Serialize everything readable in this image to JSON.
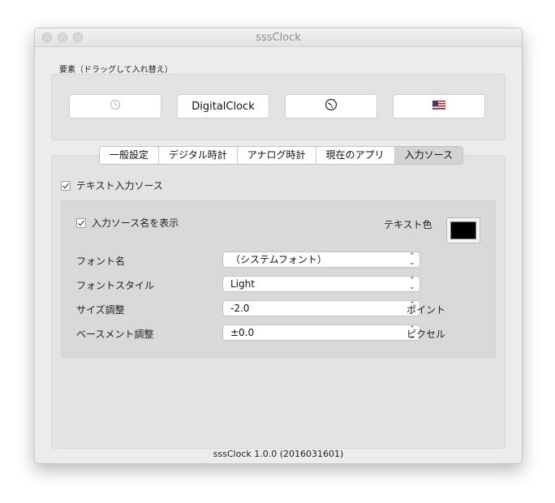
{
  "window": {
    "title": "sssClock"
  },
  "elements": {
    "label": "要素（ドラッグして入れ替え）",
    "items": [
      {
        "type": "icon",
        "icon": "clock-icon"
      },
      {
        "type": "text",
        "label": "DigitalClock"
      },
      {
        "type": "icon",
        "icon": "analog-clock-icon"
      },
      {
        "type": "icon",
        "icon": "us-flag-icon"
      }
    ]
  },
  "tabs": [
    {
      "label": "一般設定",
      "active": false
    },
    {
      "label": "デジタル時計",
      "active": false
    },
    {
      "label": "アナログ時計",
      "active": false
    },
    {
      "label": "現在のアプリ",
      "active": false
    },
    {
      "label": "入力ソース",
      "active": true
    }
  ],
  "input_source": {
    "text_source_checkbox": {
      "label": "テキスト入力ソース",
      "checked": true
    },
    "show_name_checkbox": {
      "label": "入力ソース名を表示",
      "checked": true
    },
    "text_color": {
      "label": "テキスト色",
      "value": "#000000"
    },
    "font_name": {
      "label": "フォント名",
      "value": "（システムフォント）"
    },
    "font_style": {
      "label": "フォントスタイル",
      "value": "Light"
    },
    "size_adjust": {
      "label": "サイズ調整",
      "value": "-2.0",
      "unit": "ポイント"
    },
    "baseline_adjust": {
      "label": "ベースメント調整",
      "value": "±0.0",
      "unit": "ピクセル"
    }
  },
  "footer": {
    "version": "sssClock 1.0.0 (2016031601)"
  }
}
